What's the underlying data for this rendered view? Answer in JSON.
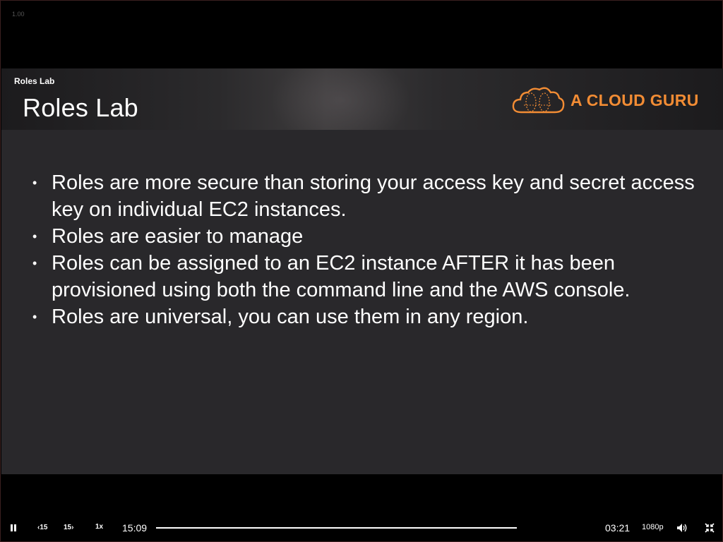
{
  "player": {
    "rate_readout": "1.00",
    "video_title": "Roles Lab"
  },
  "slide": {
    "title": "Roles Lab",
    "brand": "A CLOUD GURU",
    "bullets": [
      "Roles are more secure than storing your access key and secret access key on individual EC2 instances.",
      "Roles are easier to manage",
      "Roles can be assigned to an EC2 instance AFTER it has been provisioned using both the command line and the AWS console.",
      "Roles are universal, you can use them in any region."
    ],
    "bullet_glyph": "•"
  },
  "controls": {
    "skip_back_label": "‹15",
    "skip_forward_label": "15›",
    "rate": "1x",
    "elapsed": "15:09",
    "remaining": "03:21",
    "quality": "1080p",
    "progress_fraction": 0.82
  },
  "colors": {
    "brand_orange": "#f28c34",
    "slide_bg": "#29282b"
  }
}
